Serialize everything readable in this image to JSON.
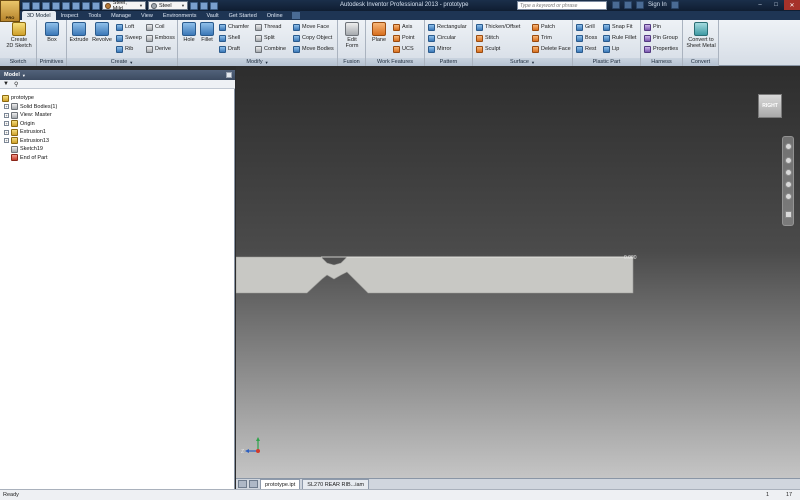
{
  "window": {
    "app_button_label": "PRO",
    "title": "Autodesk Inventor Professional 2013 - prototype",
    "search_placeholder": "Type a keyword or phrase",
    "sign_in": "Sign In",
    "material": "Steel, Mild",
    "appearance": "Steel"
  },
  "tabs": [
    "3D Model",
    "Inspect",
    "Tools",
    "Manage",
    "View",
    "Environments",
    "Vault",
    "Get Started",
    "Online"
  ],
  "ribbon": {
    "sketch": {
      "label": "Sketch",
      "create_2d_sketch": "Create\n2D Sketch"
    },
    "primitives": {
      "label": "Primitives",
      "box": "Box"
    },
    "create": {
      "label": "Create",
      "extrude": "Extrude",
      "revolve": "Revolve",
      "loft": "Loft",
      "sweep": "Sweep",
      "rib": "Rib",
      "coil": "Coil",
      "emboss": "Emboss",
      "derive": "Derive"
    },
    "modify": {
      "label": "Modify",
      "hole": "Hole",
      "fillet": "Fillet",
      "chamfer": "Chamfer",
      "shell": "Shell",
      "draft": "Draft",
      "thread": "Thread",
      "split": "Split",
      "combine": "Combine",
      "move_face": "Move Face",
      "copy_object": "Copy Object",
      "move_bodies": "Move Bodies"
    },
    "fusion": {
      "label": "Fusion",
      "edit_form": "Edit\nForm"
    },
    "work_features": {
      "label": "Work Features",
      "plane": "Plane",
      "axis": "Axis",
      "point": "Point",
      "ucs": "UCS"
    },
    "pattern": {
      "label": "Pattern",
      "rectangular": "Rectangular",
      "circular": "Circular",
      "mirror": "Mirror"
    },
    "surface": {
      "label": "Surface",
      "thicken_offset": "Thicken/Offset",
      "stitch": "Stitch",
      "sculpt": "Sculpt",
      "patch": "Patch",
      "trim": "Trim",
      "delete_face": "Delete Face"
    },
    "plastic_part": {
      "label": "Plastic Part",
      "grill": "Grill",
      "boss": "Boss",
      "rest": "Rest",
      "snap_fit": "Snap Fit",
      "rule_fillet": "Rule Fillet",
      "lip": "Lip"
    },
    "harness": {
      "label": "Harness",
      "pin": "Pin",
      "pin_group": "Pin Group",
      "properties": "Properties"
    },
    "convert": {
      "label": "Convert",
      "convert_to_sheet_metal": "Convert to\nSheet Metal"
    }
  },
  "browser": {
    "title": "Model",
    "tree": [
      {
        "label": "prototype",
        "icon": "part-icon",
        "expander": ""
      },
      {
        "label": "Solid Bodies(1)",
        "icon": "solid-bodies-icon",
        "expander": "+"
      },
      {
        "label": "View: Master",
        "icon": "view-icon",
        "expander": "+"
      },
      {
        "label": "Origin",
        "icon": "origin-folder-icon",
        "expander": "+"
      },
      {
        "label": "Extrusion1",
        "icon": "extrusion-icon",
        "expander": "+"
      },
      {
        "label": "Extrusion13",
        "icon": "extrusion-icon",
        "expander": "+"
      },
      {
        "label": "Sketch19",
        "icon": "sketch-icon",
        "expander": ""
      },
      {
        "label": "End of Part",
        "icon": "end-of-part-icon",
        "expander": ""
      }
    ]
  },
  "viewport": {
    "viewcube_face": "RIGHT",
    "part_annotation": "0.000",
    "axis_labels": {
      "x": "X",
      "y": "Y",
      "z": "Z"
    },
    "colors": {
      "part_fill": "#c8c8c4",
      "background_top": "#2d2d2d",
      "background_bottom": "#c5c5c5"
    }
  },
  "document_tabs": [
    "prototype.ipt",
    "SL270 REAR RIB...iam"
  ],
  "status": {
    "text": "Ready",
    "count_a": "1",
    "count_b": "17"
  }
}
